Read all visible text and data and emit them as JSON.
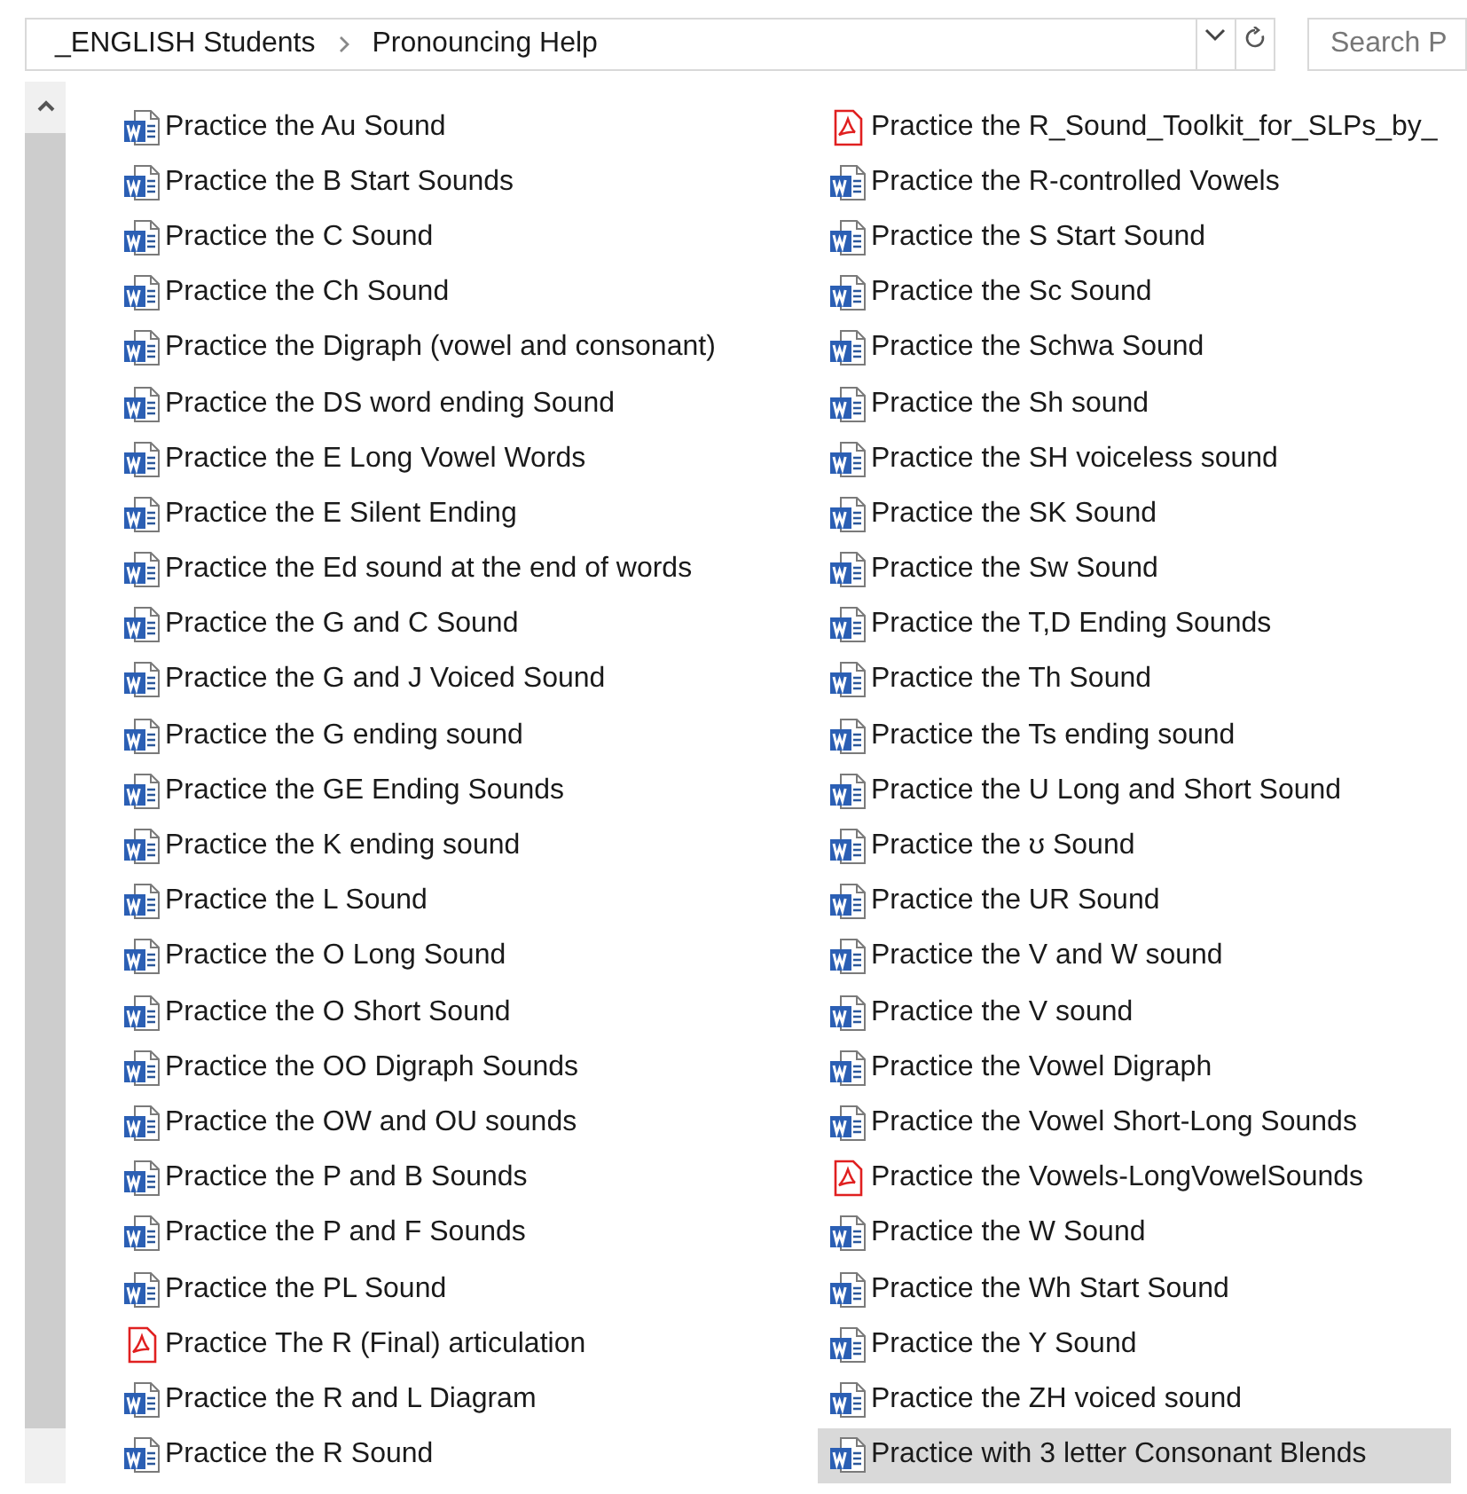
{
  "breadcrumb": [
    "_ENGLISH Students",
    "Pronouncing Help"
  ],
  "search": {
    "placeholder": "Search P"
  },
  "columns": [
    [
      {
        "name": "Practice the Au Sound",
        "kind": "word",
        "selected": false
      },
      {
        "name": "Practice the B Start Sounds",
        "kind": "word",
        "selected": false
      },
      {
        "name": "Practice the C Sound",
        "kind": "word",
        "selected": false
      },
      {
        "name": "Practice the Ch Sound",
        "kind": "word",
        "selected": false
      },
      {
        "name": "Practice the Digraph (vowel and consonant)",
        "kind": "word",
        "selected": false
      },
      {
        "name": "Practice the DS word ending Sound",
        "kind": "word",
        "selected": false
      },
      {
        "name": "Practice the E Long Vowel Words",
        "kind": "word",
        "selected": false
      },
      {
        "name": "Practice the E Silent Ending",
        "kind": "word",
        "selected": false
      },
      {
        "name": "Practice the Ed sound at the end of words",
        "kind": "word",
        "selected": false
      },
      {
        "name": "Practice the G and C Sound",
        "kind": "word",
        "selected": false
      },
      {
        "name": "Practice the G and J Voiced Sound",
        "kind": "word",
        "selected": false
      },
      {
        "name": "Practice the G ending sound",
        "kind": "word",
        "selected": false
      },
      {
        "name": "Practice the GE Ending Sounds",
        "kind": "word",
        "selected": false
      },
      {
        "name": "Practice the K ending sound",
        "kind": "word",
        "selected": false
      },
      {
        "name": "Practice the L Sound",
        "kind": "word",
        "selected": false
      },
      {
        "name": "Practice the O Long Sound",
        "kind": "word",
        "selected": false
      },
      {
        "name": "Practice the O Short Sound",
        "kind": "word",
        "selected": false
      },
      {
        "name": "Practice the OO Digraph Sounds",
        "kind": "word",
        "selected": false
      },
      {
        "name": "Practice the OW and OU sounds",
        "kind": "word",
        "selected": false
      },
      {
        "name": "Practice the P and B Sounds",
        "kind": "word",
        "selected": false
      },
      {
        "name": "Practice the P and F Sounds",
        "kind": "word",
        "selected": false
      },
      {
        "name": "Practice the PL Sound",
        "kind": "word",
        "selected": false
      },
      {
        "name": "Practice The R (Final) articulation",
        "kind": "pdf",
        "selected": false
      },
      {
        "name": "Practice the R and L Diagram",
        "kind": "word",
        "selected": false
      },
      {
        "name": "Practice the R Sound",
        "kind": "word",
        "selected": false
      }
    ],
    [
      {
        "name": "Practice the R_Sound_Toolkit_for_SLPs_by_",
        "kind": "pdf",
        "selected": false
      },
      {
        "name": "Practice the R-controlled Vowels",
        "kind": "word",
        "selected": false
      },
      {
        "name": "Practice the S Start Sound",
        "kind": "word",
        "selected": false
      },
      {
        "name": "Practice the Sc Sound",
        "kind": "word",
        "selected": false
      },
      {
        "name": "Practice the Schwa Sound",
        "kind": "word",
        "selected": false
      },
      {
        "name": "Practice the Sh sound",
        "kind": "word",
        "selected": false
      },
      {
        "name": "Practice the SH voiceless sound",
        "kind": "word",
        "selected": false
      },
      {
        "name": "Practice the SK Sound",
        "kind": "word",
        "selected": false
      },
      {
        "name": "Practice the Sw Sound",
        "kind": "word",
        "selected": false
      },
      {
        "name": "Practice the T,D Ending Sounds",
        "kind": "word",
        "selected": false
      },
      {
        "name": "Practice the Th Sound",
        "kind": "word",
        "selected": false
      },
      {
        "name": "Practice the Ts ending sound",
        "kind": "word",
        "selected": false
      },
      {
        "name": "Practice the U Long and Short Sound",
        "kind": "word",
        "selected": false
      },
      {
        "name": "Practice the ʊ Sound",
        "kind": "word",
        "selected": false
      },
      {
        "name": "Practice the UR Sound",
        "kind": "word",
        "selected": false
      },
      {
        "name": "Practice the V and W sound",
        "kind": "word",
        "selected": false
      },
      {
        "name": "Practice the V sound",
        "kind": "word",
        "selected": false
      },
      {
        "name": "Practice the Vowel Digraph",
        "kind": "word",
        "selected": false
      },
      {
        "name": "Practice the Vowel Short-Long Sounds",
        "kind": "word",
        "selected": false
      },
      {
        "name": "Practice the Vowels-LongVowelSounds",
        "kind": "pdf",
        "selected": false
      },
      {
        "name": "Practice the W Sound",
        "kind": "word",
        "selected": false
      },
      {
        "name": "Practice the Wh Start Sound",
        "kind": "word",
        "selected": false
      },
      {
        "name": "Practice the Y Sound",
        "kind": "word",
        "selected": false
      },
      {
        "name": "Practice the ZH voiced sound",
        "kind": "word",
        "selected": false
      },
      {
        "name": "Practice with 3 letter Consonant Blends",
        "kind": "word",
        "selected": true
      }
    ]
  ]
}
